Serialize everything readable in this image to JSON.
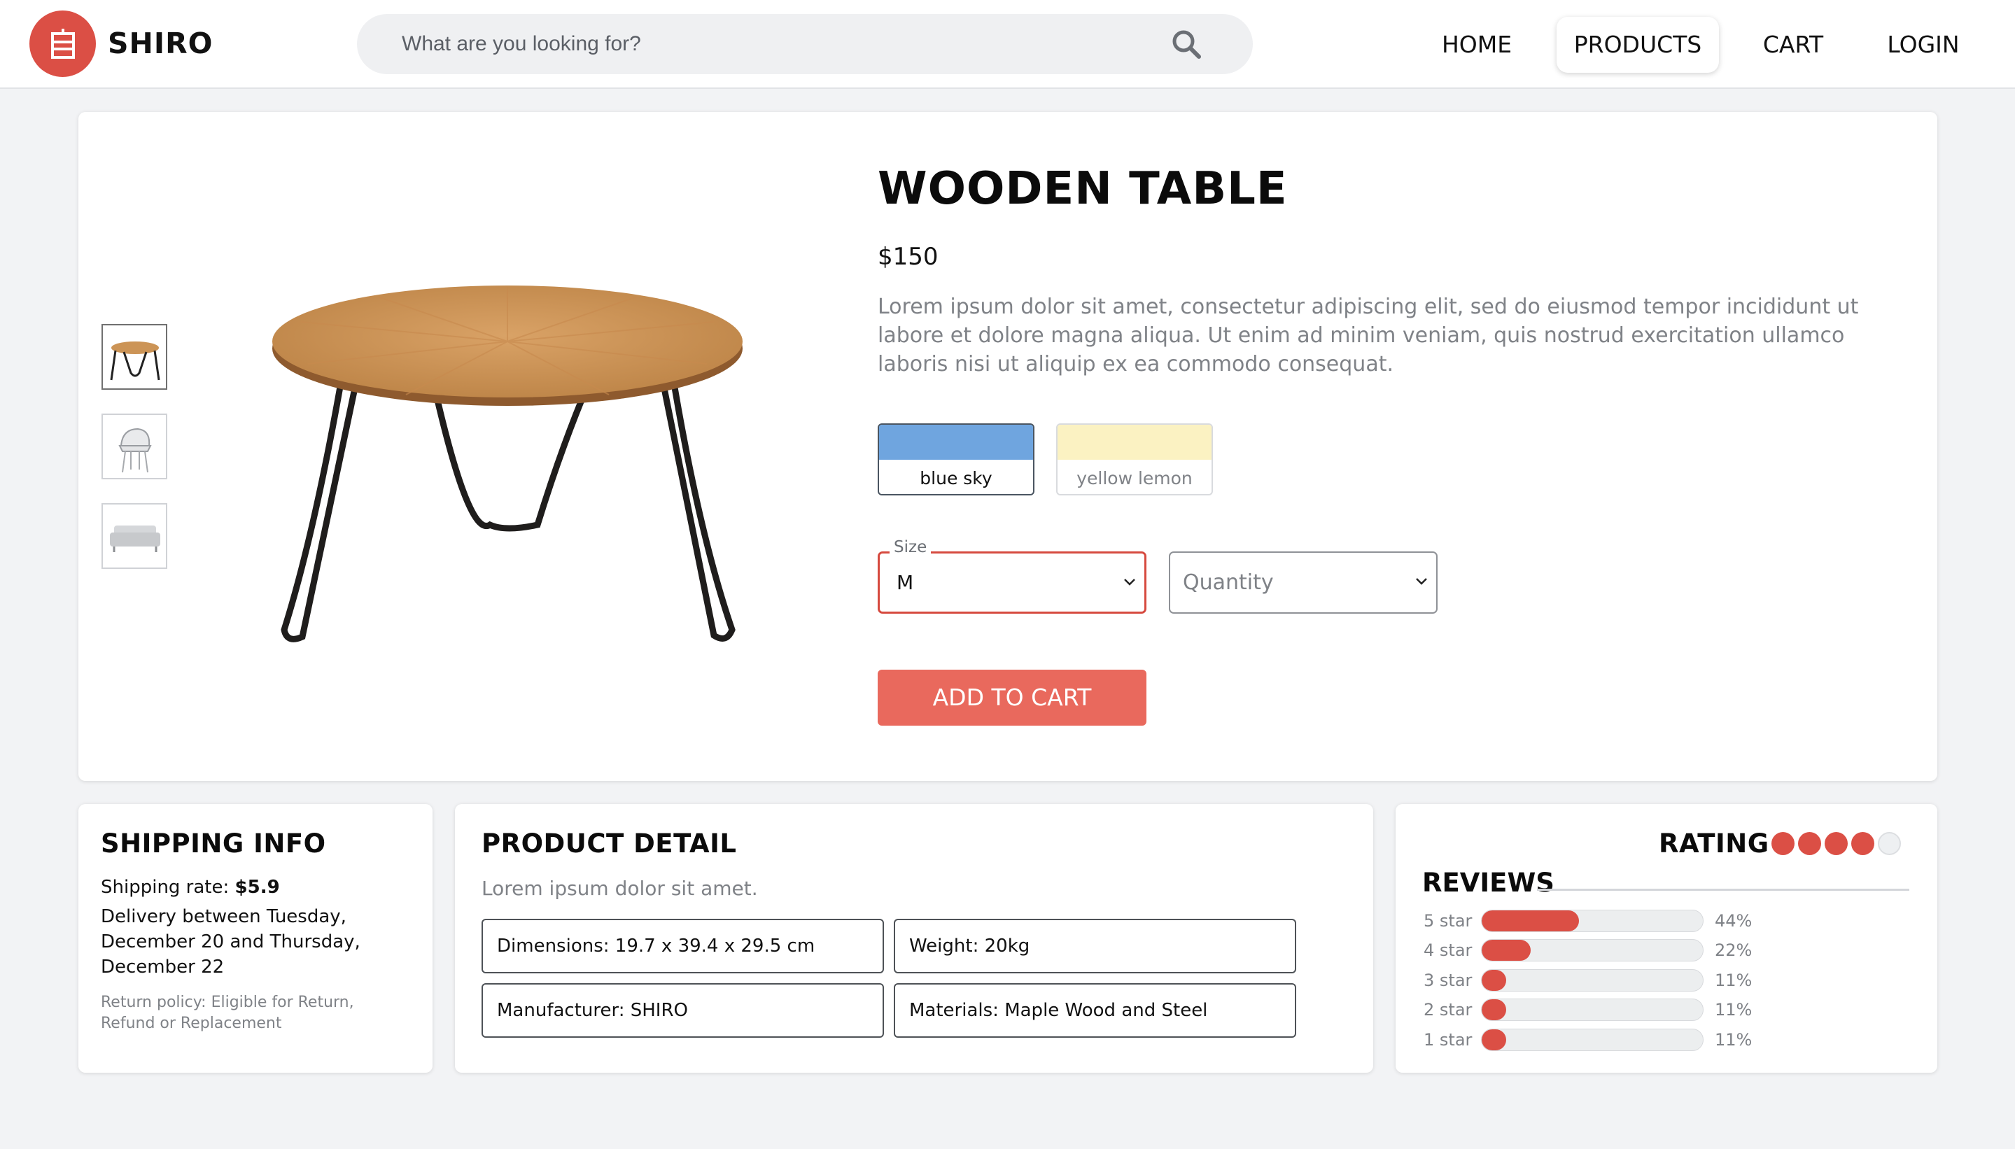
{
  "brand": {
    "name": "SHIRO",
    "accent_color": "#db4f45",
    "logo_icon": "shop-sign-icon"
  },
  "search": {
    "placeholder": "What are you looking for?",
    "icon": "search-icon"
  },
  "nav": {
    "items": [
      {
        "label": "HOME",
        "active": false
      },
      {
        "label": "PRODUCTS",
        "active": true
      },
      {
        "label": "CART",
        "active": false
      },
      {
        "label": "LOGIN",
        "active": false
      }
    ]
  },
  "product": {
    "title": "WOODEN TABLE",
    "price": "$150",
    "description": "Lorem ipsum dolor sit amet, consectetur adipiscing elit, sed do eiusmod tempor incididunt ut labore et dolore magna aliqua. Ut enim ad minim veniam, quis nostrud exercitation ullamco laboris nisi ut aliquip ex ea commodo consequat.",
    "thumbnails": [
      {
        "name": "table-thumbnail",
        "selected": true
      },
      {
        "name": "chair-thumbnail",
        "selected": false
      },
      {
        "name": "sofa-thumbnail",
        "selected": false
      }
    ],
    "colors": [
      {
        "label": "blue sky",
        "hex": "#6fa5df",
        "selected": true
      },
      {
        "label": "yellow lemon",
        "hex": "#fbf2c2",
        "selected": false
      }
    ],
    "size": {
      "legend": "Size",
      "value": "M"
    },
    "quantity": {
      "placeholder": "Quantity"
    },
    "add_to_cart_label": "ADD TO CART"
  },
  "shipping": {
    "title": "SHIPPING INFO",
    "rate_label": "Shipping rate: ",
    "rate_value": "$5.9",
    "delivery_line1": "Delivery between Tuesday,",
    "delivery_line2": "December 20 and Thursday,",
    "delivery_line3": "December 22",
    "return_policy": "Return policy: Eligible for Return, Refund or Replacement"
  },
  "product_detail": {
    "title": "PRODUCT DETAIL",
    "subtitle": "Lorem ipsum dolor sit amet.",
    "specs": [
      "Dimensions: 19.7 x 39.4 x 29.5 cm",
      "Weight: 20kg",
      "Manufacturer: SHIRO",
      "Materials: Maple Wood and Steel"
    ]
  },
  "rating": {
    "title": "RATING",
    "stars_filled": 4,
    "stars_total": 5,
    "reviews_title": "REVIEWS",
    "breakdown": [
      {
        "label": "5 star",
        "percent": 44,
        "percent_label": "44%"
      },
      {
        "label": "4 star",
        "percent": 22,
        "percent_label": "22%"
      },
      {
        "label": "3 star",
        "percent": 11,
        "percent_label": "11%"
      },
      {
        "label": "2 star",
        "percent": 11,
        "percent_label": "11%"
      },
      {
        "label": "1 star",
        "percent": 11,
        "percent_label": "11%"
      }
    ]
  }
}
